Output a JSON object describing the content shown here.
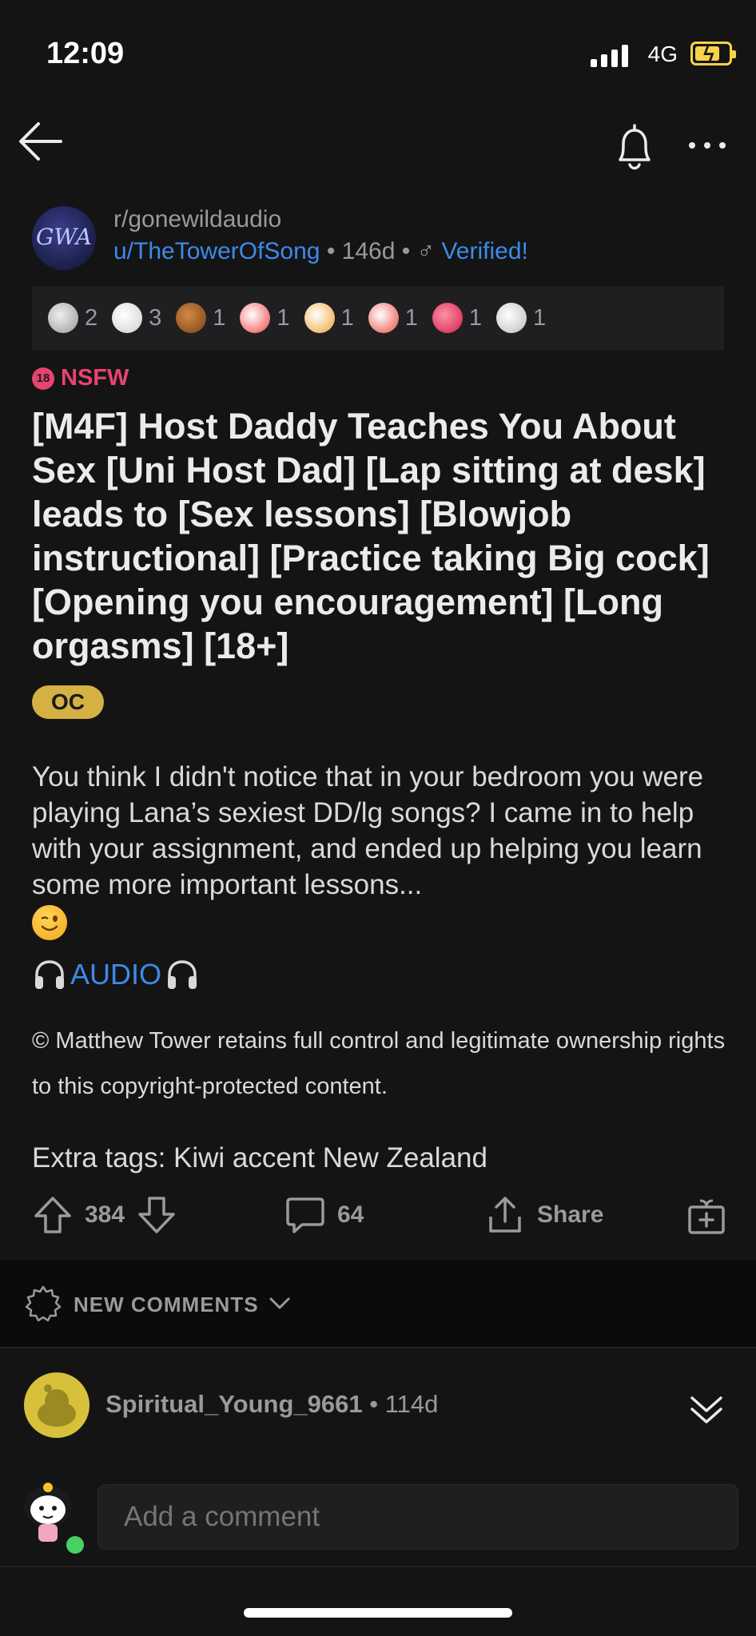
{
  "status_bar": {
    "time": "12:09",
    "network": "4G"
  },
  "post": {
    "subreddit": "r/gonewildaudio",
    "avatar_text": "GWA",
    "author": "u/TheTowerOfSong",
    "age": "146d",
    "flair_symbol": "♂",
    "flair_text": "Verified!",
    "awards": [
      {
        "icon": "award-1-icon",
        "count": "2"
      },
      {
        "icon": "award-2-icon",
        "count": "3"
      },
      {
        "icon": "award-3-icon",
        "count": "1"
      },
      {
        "icon": "award-4-icon",
        "count": "1"
      },
      {
        "icon": "award-5-icon",
        "count": "1"
      },
      {
        "icon": "award-6-icon",
        "count": "1"
      },
      {
        "icon": "award-7-icon",
        "count": "1"
      },
      {
        "icon": "award-8-icon",
        "count": "1"
      }
    ],
    "nsfw_label": "NSFW",
    "nsfw_icon_text": "18",
    "title": "[M4F] Host Daddy Teaches You About Sex [Uni Host Dad] [Lap sitting at desk] leads to [Sex lessons] [Blowjob instructional] [Practice taking Big cock] [Opening you encouragement] [Long orgasms] [18+]",
    "oc_label": "OC",
    "body": "You think I didn't notice that in your bedroom you were playing Lana’s sexiest DD/lg songs? I came in to help with your assignment, and ended up helping you learn some more important lessons...",
    "audio_label": "AUDIO",
    "copyright": "© Matthew Tower retains full control and legitimate ownership rights to this copyright-protected content.",
    "extra_tags": "Extra tags: Kiwi accent New Zealand",
    "votes": "384",
    "comments": "64",
    "share_label": "Share"
  },
  "comments_section": {
    "sort_label": "NEW COMMENTS",
    "first_comment": {
      "author": "Spiritual_Young_9661",
      "age": "114d"
    },
    "composer_placeholder": "Add a comment"
  },
  "colors": {
    "background": "#141415",
    "link": "#3d8ae8",
    "nsfw": "#e7446f",
    "oc_badge": "#d4b142"
  }
}
